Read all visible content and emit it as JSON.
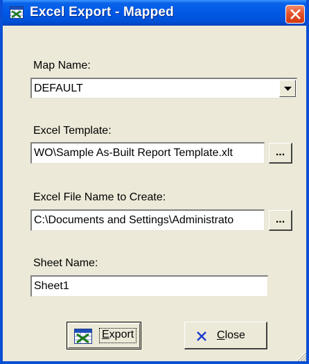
{
  "window": {
    "title": "Excel Export - Mapped",
    "title_icon": "excel-export-icon",
    "close_icon": "close-icon"
  },
  "map_name": {
    "label": "Map Name:",
    "value": "DEFAULT"
  },
  "excel_template": {
    "label": "Excel Template:",
    "value": "WO\\Sample As-Built Report Template.xlt",
    "browse_label": "..."
  },
  "excel_file": {
    "label": "Excel File Name to Create:",
    "value": "C:\\Documents and Settings\\Administrato",
    "browse_label": "..."
  },
  "sheet_name": {
    "label": "Sheet Name:",
    "value": "Sheet1"
  },
  "buttons": {
    "export_first": "E",
    "export_rest": "xport",
    "close_first": "C",
    "close_rest": "lose"
  },
  "colors": {
    "titlebar": "#0058e6",
    "close_button": "#e5542b",
    "dialog_bg": "#ece9d8"
  }
}
